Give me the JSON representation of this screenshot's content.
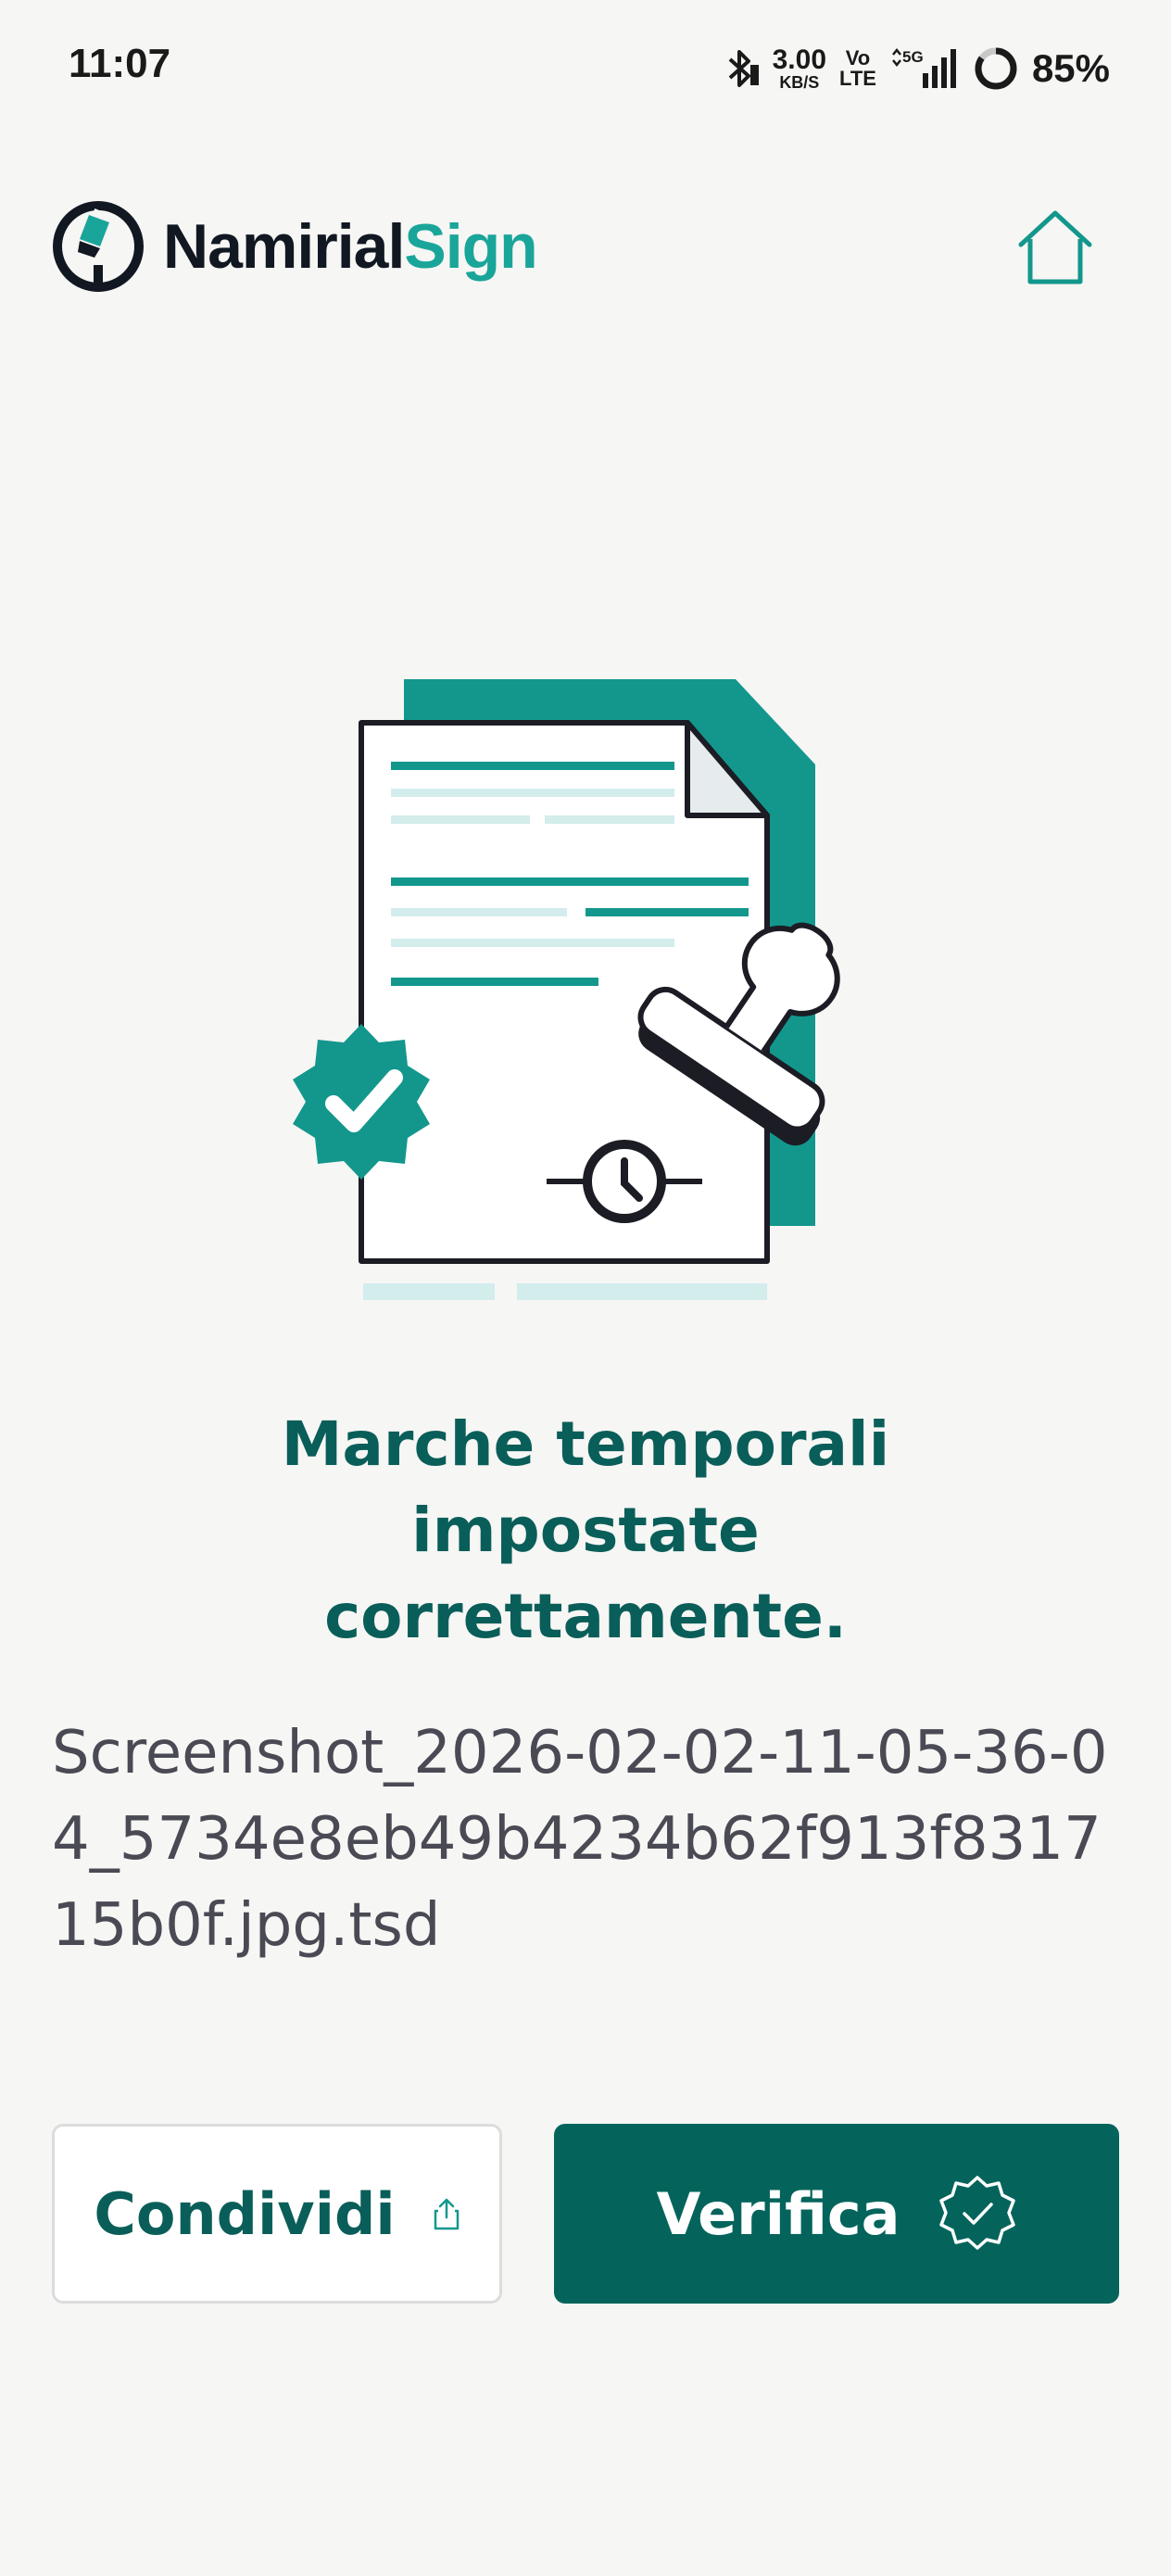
{
  "status_bar": {
    "time": "11:07",
    "net_speed_value": "3.00",
    "net_speed_unit": "KB/S",
    "volte_top": "Vo",
    "volte_bottom": "LTE",
    "network": "5G",
    "battery": "85%",
    "battery_level_percent": 85
  },
  "header": {
    "logo_part1": "Namirial",
    "logo_part2": "Sign"
  },
  "message": {
    "title": "Marche temporali impostate correttamente."
  },
  "file": {
    "name": "Screenshot_2026-02-02-11-05-36-04_5734e8eb49b4234b62f913f831715b0f.jpg.tsd"
  },
  "actions": {
    "share_label": "Condividi",
    "verify_label": "Verifica"
  },
  "colors": {
    "accent": "#04645c",
    "teal": "#13978d",
    "title": "#0a5e59",
    "background": "#f6f6f4"
  }
}
